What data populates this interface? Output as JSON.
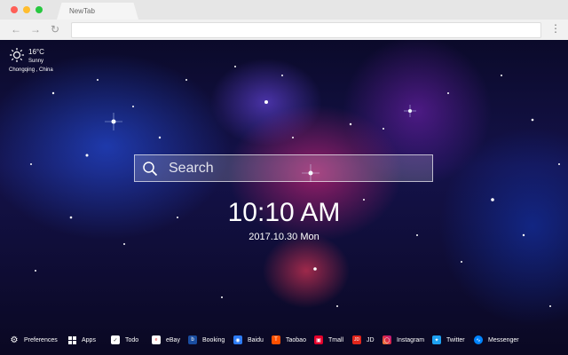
{
  "browser": {
    "tab_title": "NewTab",
    "colors": {
      "close": "#ff5f57",
      "minimize": "#ffbd2e",
      "maximize": "#28c840"
    }
  },
  "weather": {
    "temperature": "16°C",
    "condition": "Sunny",
    "location": "Chongqing , China",
    "icon": "sun-icon"
  },
  "search": {
    "placeholder": "Search",
    "icon": "search-icon"
  },
  "clock": {
    "time": "10:10 AM",
    "date": "2017.10.30 Mon"
  },
  "bottom_bar": {
    "preferences": "Preferences",
    "apps": "Apps",
    "todo": "Todo",
    "shortcuts": [
      {
        "label": "eBay",
        "icon": "ebay-icon",
        "color": "#ffffff"
      },
      {
        "label": "Booking",
        "icon": "booking-icon",
        "color": "#1a4da1"
      },
      {
        "label": "Baidu",
        "icon": "baidu-icon",
        "color": "#2d7bf4"
      },
      {
        "label": "Taobao",
        "icon": "taobao-icon",
        "color": "#ff5000"
      },
      {
        "label": "Tmall",
        "icon": "tmall-icon",
        "color": "#e4002b"
      },
      {
        "label": "JD",
        "icon": "jd-icon",
        "color": "#e1251b"
      },
      {
        "label": "Instagram",
        "icon": "instagram-icon",
        "color": "#c13584"
      },
      {
        "label": "Twitter",
        "icon": "twitter-icon",
        "color": "#1da1f2"
      },
      {
        "label": "Messenger",
        "icon": "messenger-icon",
        "color": "#0084ff"
      }
    ]
  }
}
